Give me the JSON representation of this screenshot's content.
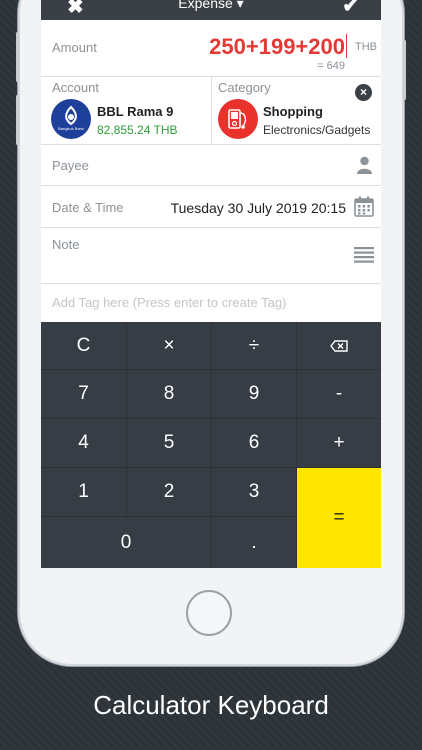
{
  "topbar": {
    "close": "✖",
    "title": "Expense ▾",
    "confirm": "✔"
  },
  "amount": {
    "label": "Amount",
    "expression": "250+199+200",
    "currency": "THB",
    "result": "= 649"
  },
  "account": {
    "label": "Account",
    "name": "BBL Rama 9",
    "balance": "82,855.24 THB",
    "logo_text": "Bangkok Bank"
  },
  "category": {
    "label": "Category",
    "name": "Shopping",
    "sub": "Electronics/Gadgets"
  },
  "payee": {
    "label": "Payee"
  },
  "datetime": {
    "label": "Date & Time",
    "value": "Tuesday 30 July 2019 20:15"
  },
  "note": {
    "label": "Note"
  },
  "tag": {
    "placeholder": "Add Tag here (Press enter to create Tag)"
  },
  "keypad": {
    "clear": "C",
    "multiply": "×",
    "divide": "÷",
    "backspace": "⌫",
    "k7": "7",
    "k8": "8",
    "k9": "9",
    "minus": "-",
    "k4": "4",
    "k5": "5",
    "k6": "6",
    "plus": "+",
    "k1": "1",
    "k2": "2",
    "k3": "3",
    "k0": "0",
    "dot": ".",
    "equals": "="
  },
  "caption": "Calculator Keyboard",
  "colors": {
    "amount": "#e53935",
    "balance": "#2e9e3b",
    "equals_key": "#ffe600",
    "keypad": "#363d44"
  }
}
